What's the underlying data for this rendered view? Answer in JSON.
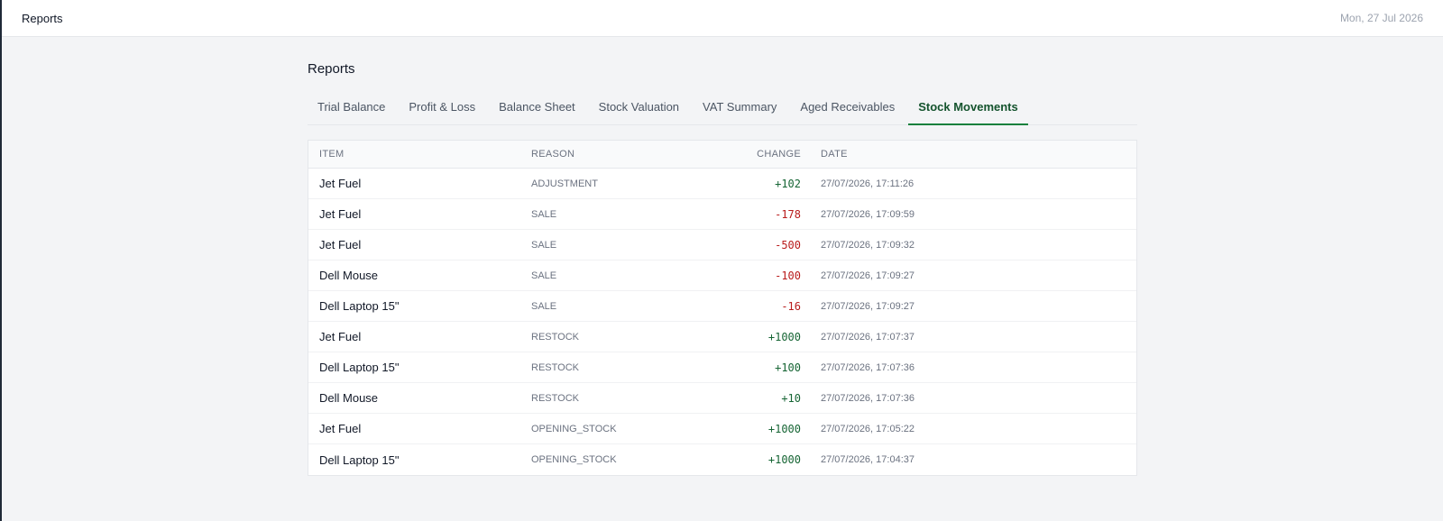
{
  "topbar": {
    "title": "Reports",
    "date": "Mon, 27 Jul 2026"
  },
  "page": {
    "title": "Reports"
  },
  "tabs": [
    {
      "label": "Trial Balance",
      "active": false
    },
    {
      "label": "Profit & Loss",
      "active": false
    },
    {
      "label": "Balance Sheet",
      "active": false
    },
    {
      "label": "Stock Valuation",
      "active": false
    },
    {
      "label": "VAT Summary",
      "active": false
    },
    {
      "label": "Aged Receivables",
      "active": false
    },
    {
      "label": "Stock Movements",
      "active": true
    }
  ],
  "table": {
    "columns": [
      "ITEM",
      "REASON",
      "CHANGE",
      "DATE"
    ],
    "rows": [
      {
        "item": "Jet Fuel",
        "reason": "ADJUSTMENT",
        "change": "+102",
        "date": "27/07/2026, 17:11:26"
      },
      {
        "item": "Jet Fuel",
        "reason": "SALE",
        "change": "-178",
        "date": "27/07/2026, 17:09:59"
      },
      {
        "item": "Jet Fuel",
        "reason": "SALE",
        "change": "-500",
        "date": "27/07/2026, 17:09:32"
      },
      {
        "item": "Dell Mouse",
        "reason": "SALE",
        "change": "-100",
        "date": "27/07/2026, 17:09:27"
      },
      {
        "item": "Dell Laptop 15\"",
        "reason": "SALE",
        "change": "-16",
        "date": "27/07/2026, 17:09:27"
      },
      {
        "item": "Jet Fuel",
        "reason": "RESTOCK",
        "change": "+1000",
        "date": "27/07/2026, 17:07:37"
      },
      {
        "item": "Dell Laptop 15\"",
        "reason": "RESTOCK",
        "change": "+100",
        "date": "27/07/2026, 17:07:36"
      },
      {
        "item": "Dell Mouse",
        "reason": "RESTOCK",
        "change": "+10",
        "date": "27/07/2026, 17:07:36"
      },
      {
        "item": "Jet Fuel",
        "reason": "OPENING_STOCK",
        "change": "+1000",
        "date": "27/07/2026, 17:05:22"
      },
      {
        "item": "Dell Laptop 15\"",
        "reason": "OPENING_STOCK",
        "change": "+1000",
        "date": "27/07/2026, 17:04:37"
      }
    ]
  },
  "colors": {
    "positive": "#166534",
    "negative": "#b91c1c",
    "accent": "#15803d"
  }
}
